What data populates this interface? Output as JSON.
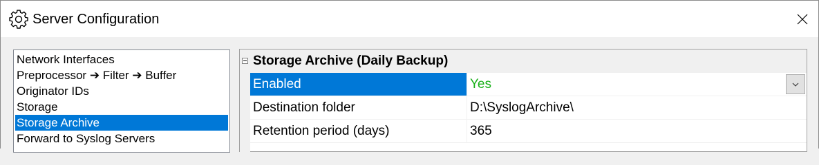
{
  "window": {
    "title": "Server Configuration",
    "icons": {
      "app": "gear-icon",
      "close": "close-icon"
    }
  },
  "sidebar": {
    "items": [
      {
        "label": "Network Interfaces",
        "selected": false
      },
      {
        "label": "Preprocessor ➔ Filter ➔ Buffer",
        "selected": false
      },
      {
        "label": "Originator IDs",
        "selected": false
      },
      {
        "label": "Storage",
        "selected": false
      },
      {
        "label": "Storage Archive",
        "selected": true
      },
      {
        "label": "Forward to Syslog Servers",
        "selected": false
      }
    ]
  },
  "property_grid": {
    "category": {
      "title": "Storage Archive (Daily Backup)",
      "expanded": true,
      "icon": "collapse-minus-icon"
    },
    "properties": [
      {
        "name": "Enabled",
        "value": "Yes",
        "selected": true,
        "has_dropdown": true
      },
      {
        "name": "Destination folder",
        "value": "D:\\SyslogArchive\\",
        "selected": false
      },
      {
        "name": "Retention period (days)",
        "value": "365",
        "selected": false
      }
    ]
  },
  "colors": {
    "selection": "#0078d7",
    "value_yes": "#1ab11a",
    "window_bg": "#f0f0f0"
  }
}
